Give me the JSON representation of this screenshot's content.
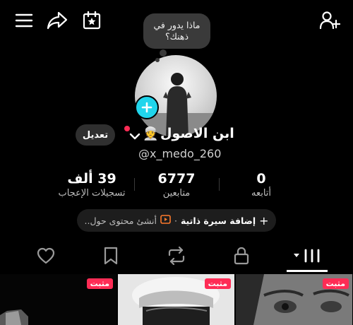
{
  "bubble": {
    "text": "ماذا يدور في ذهنك؟"
  },
  "profile": {
    "display_name": "ابن الاصول",
    "emoji": "👳",
    "handle": "@x_medo_260",
    "edit_label": "تعديل"
  },
  "stats": [
    {
      "value": "39 ألف",
      "label": "تسجيلات الإعجاب"
    },
    {
      "value": "6777",
      "label": "متابعين"
    },
    {
      "value": "0",
      "label": "أتابعه"
    }
  ],
  "bio": {
    "add_label": "إضافة سيرة ذاتية",
    "separator": "·",
    "create_label": "أنشئ محتوى حول..",
    "plus": "+"
  },
  "videos": [
    {
      "badge": "مثبت"
    },
    {
      "badge": "مثبت"
    },
    {
      "badge": "مثبت"
    }
  ],
  "colors": {
    "accent_plus": "#20d5ec",
    "badge": "#fe2c55",
    "background": "#000000"
  }
}
